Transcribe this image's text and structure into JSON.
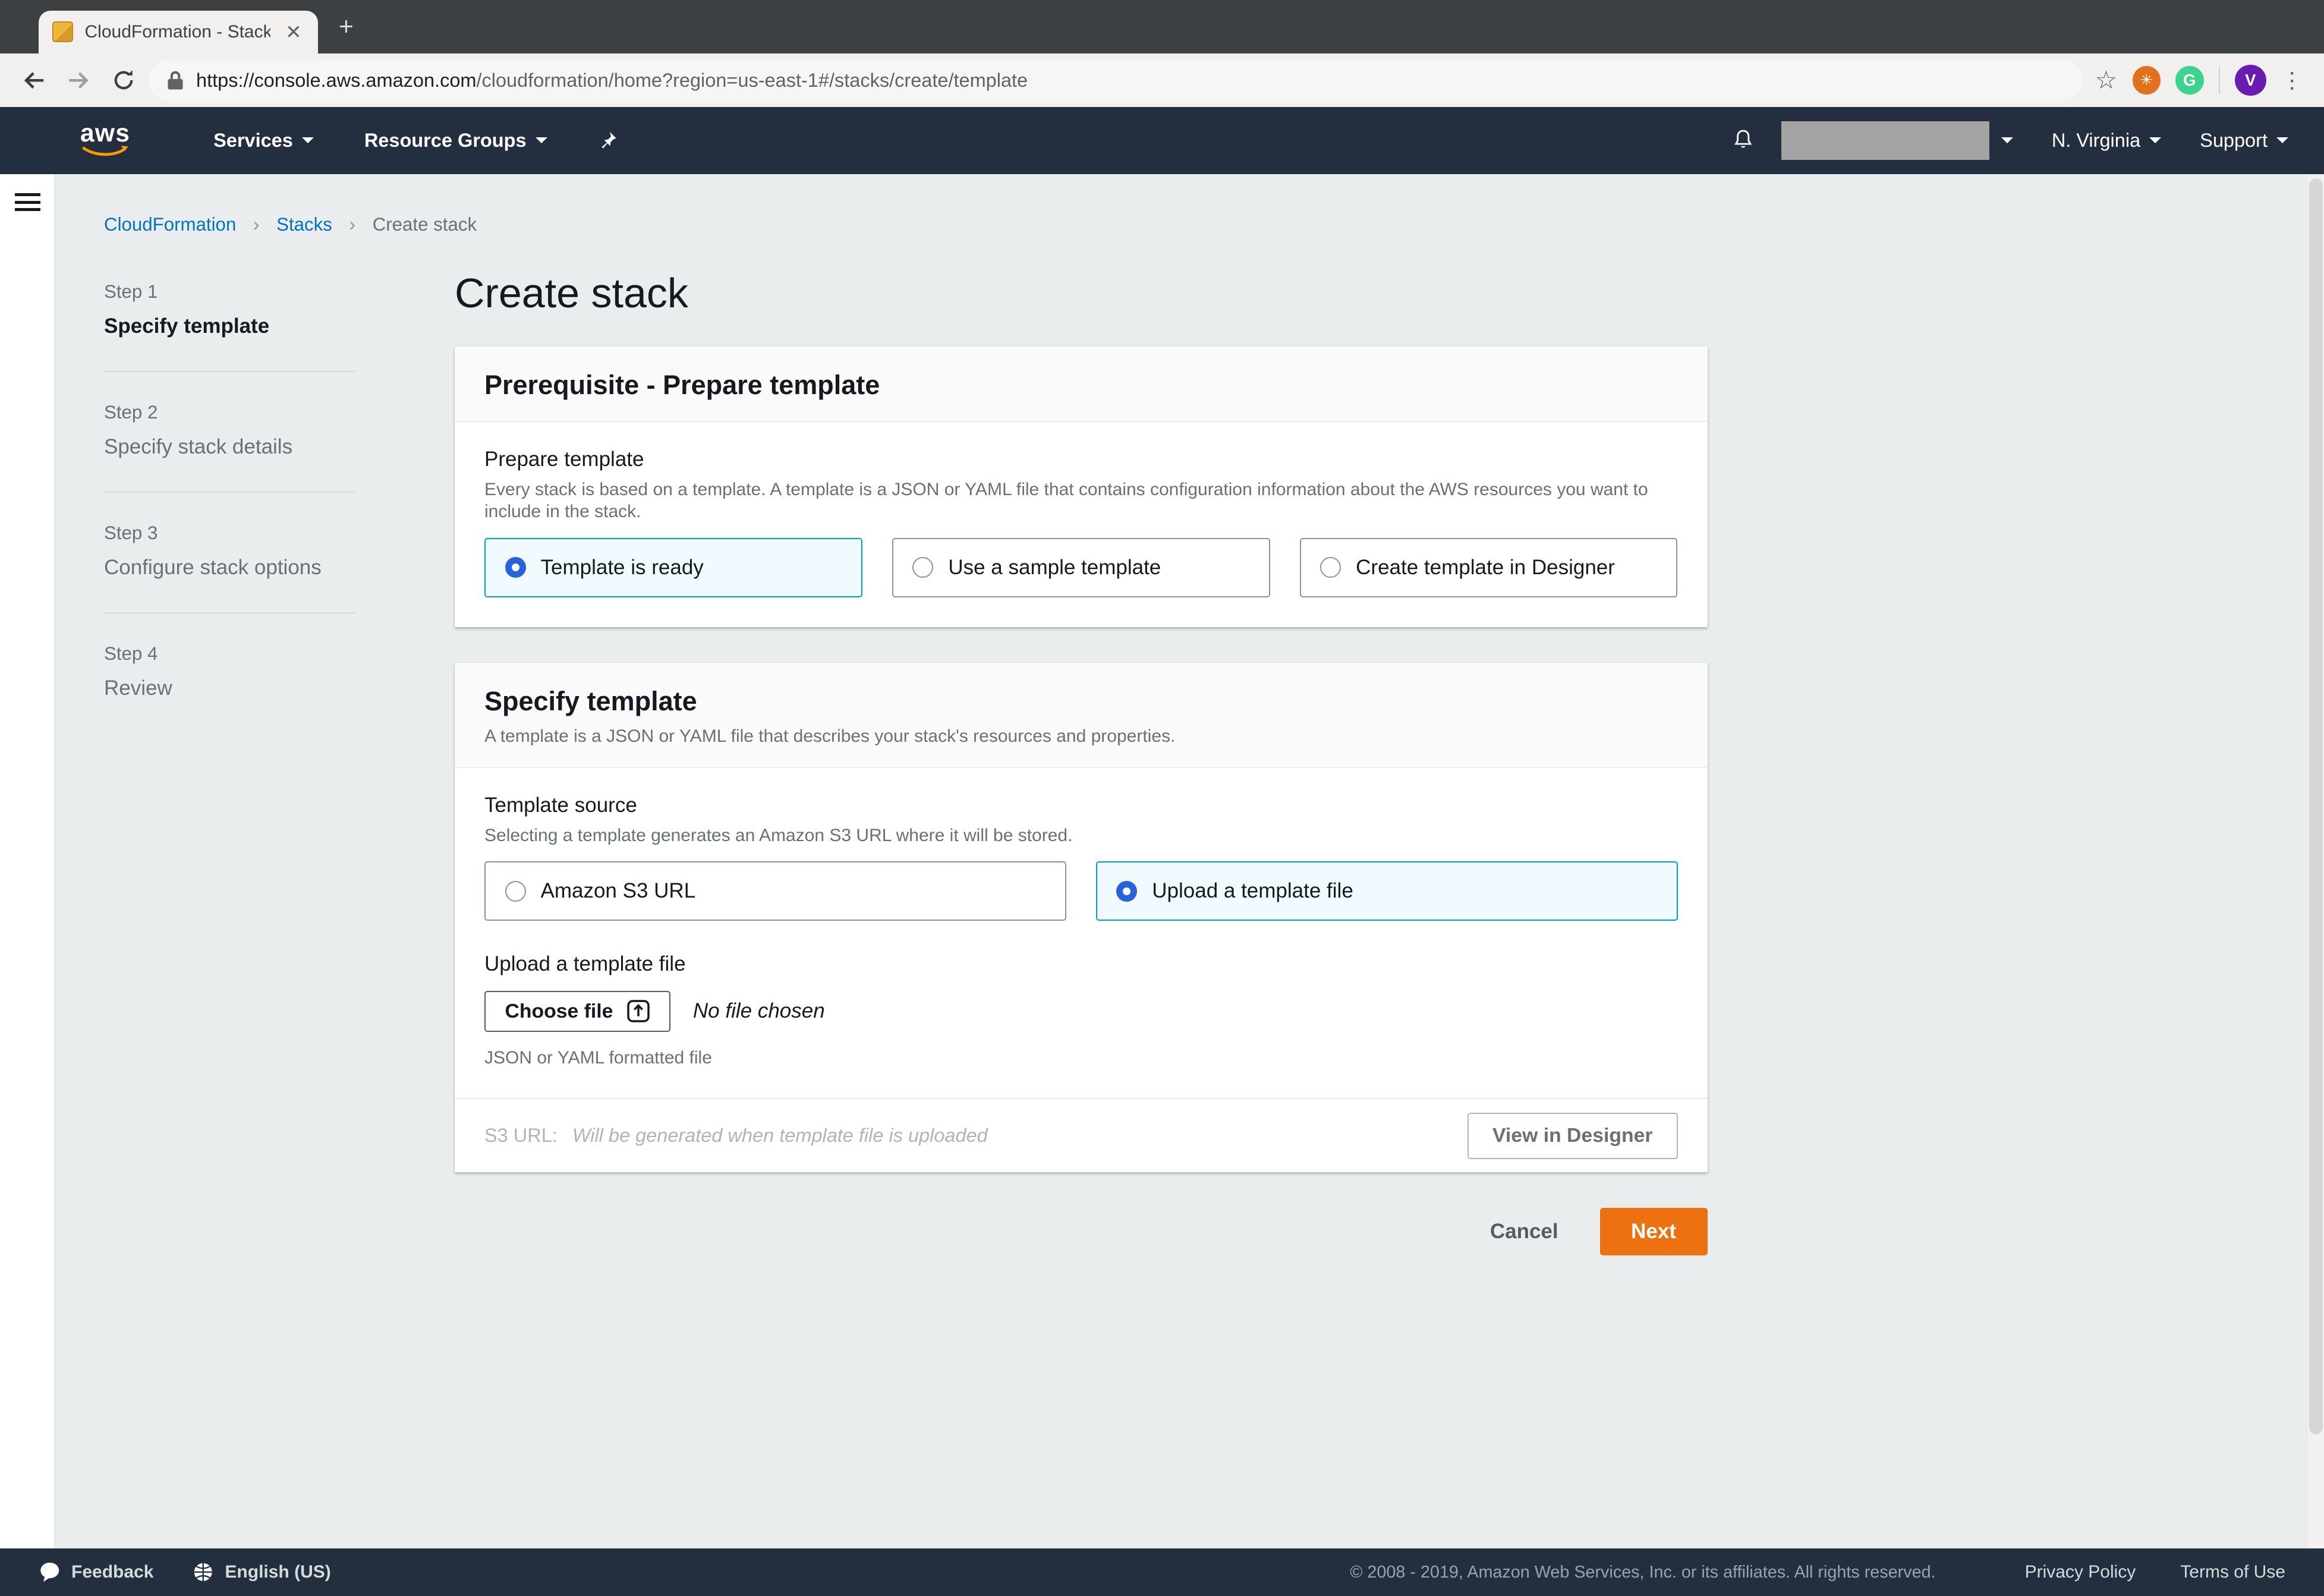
{
  "browser": {
    "tab_title": "CloudFormation - Stack",
    "url_domain": "https://console.aws.amazon.com",
    "url_path": "/cloudformation/home?region=us-east-1#/stacks/create/template",
    "extension_letter": "G",
    "avatar_letter": "V"
  },
  "nav": {
    "logo": "aws",
    "services": "Services",
    "resource_groups": "Resource Groups",
    "region": "N. Virginia",
    "support": "Support"
  },
  "breadcrumb": {
    "items": [
      "CloudFormation",
      "Stacks",
      "Create stack"
    ]
  },
  "steps": [
    {
      "step": "Step 1",
      "title": "Specify template"
    },
    {
      "step": "Step 2",
      "title": "Specify stack details"
    },
    {
      "step": "Step 3",
      "title": "Configure stack options"
    },
    {
      "step": "Step 4",
      "title": "Review"
    }
  ],
  "main": {
    "heading": "Create stack",
    "prereq": {
      "title": "Prerequisite - Prepare template",
      "label": "Prepare template",
      "description": "Every stack is based on a template. A template is a JSON or YAML file that contains configuration information about the AWS resources you want to include in the stack.",
      "options": [
        {
          "label": "Template is ready",
          "selected": true
        },
        {
          "label": "Use a sample template",
          "selected": false
        },
        {
          "label": "Create template in Designer",
          "selected": false
        }
      ]
    },
    "specify": {
      "title": "Specify template",
      "description": "A template is a JSON or YAML file that describes your stack's resources and properties.",
      "source_label": "Template source",
      "source_description": "Selecting a template generates an Amazon S3 URL where it will be stored.",
      "options": [
        {
          "label": "Amazon S3 URL",
          "selected": false
        },
        {
          "label": "Upload a template file",
          "selected": true
        }
      ],
      "upload_label": "Upload a template file",
      "choose_file": "Choose file",
      "no_file": "No file chosen",
      "file_help": "JSON or YAML formatted file",
      "s3_label": "S3 URL:",
      "s3_value": "Will be generated when template file is uploaded",
      "view_designer": "View in Designer"
    },
    "actions": {
      "cancel": "Cancel",
      "next": "Next"
    }
  },
  "footer": {
    "feedback": "Feedback",
    "language": "English (US)",
    "copyright": "© 2008 - 2019, Amazon Web Services, Inc. or its affiliates. All rights reserved.",
    "privacy": "Privacy Policy",
    "terms": "Terms of Use"
  },
  "colors": {
    "accent_orange": "#ec7211",
    "link_blue": "#0073bb",
    "nav_dark": "#232f3e",
    "selected_tile_bg": "#f1faff",
    "selected_tile_border": "#00a1c9",
    "radio_blue": "#2662d9"
  }
}
